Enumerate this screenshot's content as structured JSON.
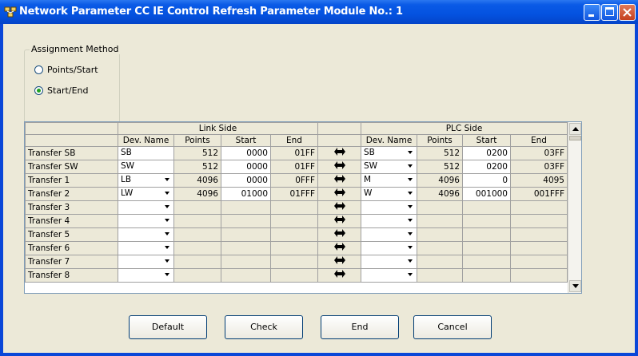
{
  "window": {
    "title": "Network Parameter  CC IE Control Refresh Parameter Module No.: 1",
    "minimize_icon": "minimize-icon",
    "maximize_icon": "maximize-icon",
    "close_icon": "close-icon"
  },
  "assignment": {
    "legend": "Assignment Method",
    "options": [
      {
        "label": "Points/Start",
        "selected": false
      },
      {
        "label": "Start/End",
        "selected": true
      }
    ]
  },
  "grid": {
    "link_side": "Link Side",
    "plc_side": "PLC Side",
    "columns": [
      "Dev. Name",
      "Points",
      "Start",
      "End"
    ],
    "rows": [
      {
        "label": "Transfer SB",
        "link": {
          "dev": "SB",
          "points": "512",
          "start": "0000",
          "end": "01FF",
          "dd": false
        },
        "plc": {
          "dev": "SB",
          "points": "512",
          "start": "0200",
          "end": "03FF",
          "dd": true
        }
      },
      {
        "label": "Transfer SW",
        "link": {
          "dev": "SW",
          "points": "512",
          "start": "0000",
          "end": "01FF",
          "dd": false
        },
        "plc": {
          "dev": "SW",
          "points": "512",
          "start": "0200",
          "end": "03FF",
          "dd": true
        }
      },
      {
        "label": "Transfer 1",
        "link": {
          "dev": "LB",
          "points": "4096",
          "start": "0000",
          "end": "0FFF",
          "dd": true
        },
        "plc": {
          "dev": "M",
          "points": "4096",
          "start": "0",
          "end": "4095",
          "dd": true
        }
      },
      {
        "label": "Transfer 2",
        "link": {
          "dev": "LW",
          "points": "4096",
          "start": "01000",
          "end": "01FFF",
          "dd": true
        },
        "plc": {
          "dev": "W",
          "points": "4096",
          "start": "001000",
          "end": "001FFF",
          "dd": true
        }
      },
      {
        "label": "Transfer 3",
        "link": {
          "dev": "",
          "points": "",
          "start": "",
          "end": "",
          "dd": true
        },
        "plc": {
          "dev": "",
          "points": "",
          "start": "",
          "end": "",
          "dd": true
        }
      },
      {
        "label": "Transfer 4",
        "link": {
          "dev": "",
          "points": "",
          "start": "",
          "end": "",
          "dd": true
        },
        "plc": {
          "dev": "",
          "points": "",
          "start": "",
          "end": "",
          "dd": true
        }
      },
      {
        "label": "Transfer 5",
        "link": {
          "dev": "",
          "points": "",
          "start": "",
          "end": "",
          "dd": true
        },
        "plc": {
          "dev": "",
          "points": "",
          "start": "",
          "end": "",
          "dd": true
        }
      },
      {
        "label": "Transfer 6",
        "link": {
          "dev": "",
          "points": "",
          "start": "",
          "end": "",
          "dd": true
        },
        "plc": {
          "dev": "",
          "points": "",
          "start": "",
          "end": "",
          "dd": true
        }
      },
      {
        "label": "Transfer 7",
        "link": {
          "dev": "",
          "points": "",
          "start": "",
          "end": "",
          "dd": true
        },
        "plc": {
          "dev": "",
          "points": "",
          "start": "",
          "end": "",
          "dd": true
        }
      },
      {
        "label": "Transfer 8",
        "link": {
          "dev": "",
          "points": "",
          "start": "",
          "end": "",
          "dd": true
        },
        "plc": {
          "dev": "",
          "points": "",
          "start": "",
          "end": "",
          "dd": true
        }
      }
    ],
    "transfer_icon": "double-arrow-icon"
  },
  "buttons": {
    "default": "Default",
    "check": "Check",
    "end": "End",
    "cancel": "Cancel"
  }
}
